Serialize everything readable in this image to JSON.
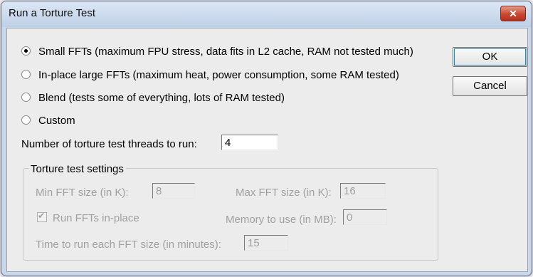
{
  "window": {
    "title": "Run a Torture Test",
    "close_glyph": "✕"
  },
  "options": [
    {
      "label": "Small FFTs (maximum FPU stress, data fits in L2 cache, RAM not tested much)",
      "selected": true
    },
    {
      "label": "In-place large FFTs (maximum heat, power consumption, some RAM tested)",
      "selected": false
    },
    {
      "label": "Blend (tests some of everything, lots of RAM tested)",
      "selected": false
    },
    {
      "label": "Custom",
      "selected": false
    }
  ],
  "buttons": {
    "ok": "OK",
    "cancel": "Cancel"
  },
  "threads": {
    "label": "Number of torture test threads to run:",
    "value": "4"
  },
  "settings": {
    "group_label": "Torture test settings",
    "min_fft_label": "Min FFT size (in K):",
    "min_fft_value": "8",
    "max_fft_label": "Max FFT size (in K):",
    "max_fft_value": "16",
    "run_inplace_label": "Run FFTs in-place",
    "run_inplace_checked": true,
    "memory_label": "Memory to use (in MB):",
    "memory_value": "0",
    "time_label": "Time to run each FFT size (in minutes):",
    "time_value": "15"
  }
}
